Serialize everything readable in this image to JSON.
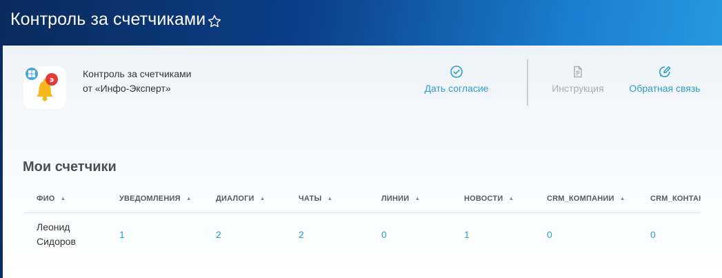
{
  "header": {
    "title": "Контроль за счетчиками",
    "favorite_icon": "star-outline-icon"
  },
  "app": {
    "icon": "bell-app-icon",
    "title_line1": "Контроль за счетчиками",
    "title_line2": "от «Инфо-Эксперт»"
  },
  "actions": {
    "consent_label": "Дать согласие",
    "consent_icon": "check-circle-icon",
    "guide_label": "Инструкция",
    "guide_icon": "document-icon",
    "feedback_label": "Обратная связь",
    "feedback_icon": "edit-bubble-icon"
  },
  "section": {
    "title": "Мои счетчики"
  },
  "table": {
    "columns": [
      "ФИО",
      "УВЕДОМЛЕНИЯ",
      "ДИАЛОГИ",
      "ЧАТЫ",
      "ЛИНИИ",
      "НОВОСТИ",
      "CRM_КОМПАНИИ",
      "CRM_КОНТАКТ"
    ],
    "rows": [
      {
        "name": "Леонид Сидоров",
        "values": [
          "1",
          "2",
          "2",
          "0",
          "1",
          "0",
          "0"
        ]
      }
    ]
  },
  "colors": {
    "accent": "#2b9dcf",
    "muted": "#a7aeb4",
    "header_dark": "#0a2a5c",
    "header_light": "#2aa0e6"
  }
}
